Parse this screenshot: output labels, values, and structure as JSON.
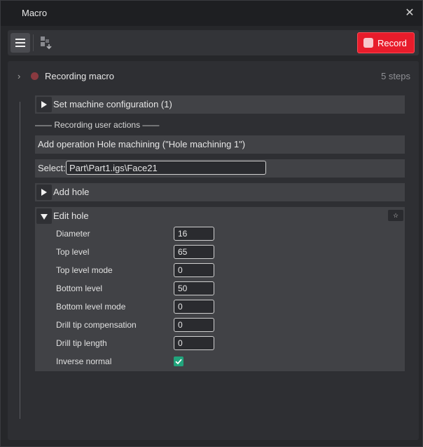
{
  "window": {
    "title": "Macro"
  },
  "toolbar": {
    "record_label": "Record"
  },
  "recording": {
    "title": "Recording macro",
    "steps": "5 steps"
  },
  "steps": {
    "set_machine": "Set machine configuration (1)",
    "section_label": "—— Recording user actions ——",
    "add_operation": "Add operation Hole machining (\"Hole machining 1\")",
    "select_label": "Select:",
    "select_value": "Part\\Part1.igs\\Face21",
    "add_hole": "Add hole",
    "edit_hole": "Edit hole"
  },
  "edit_hole": {
    "params": [
      {
        "label": "Diameter",
        "value": "16"
      },
      {
        "label": "Top level",
        "value": "65"
      },
      {
        "label": "Top level mode",
        "value": "0"
      },
      {
        "label": "Bottom level",
        "value": "50"
      },
      {
        "label": "Bottom level mode",
        "value": "0"
      },
      {
        "label": "Drill tip compensation",
        "value": "0"
      },
      {
        "label": "Drill tip length",
        "value": "0"
      }
    ],
    "inverse_normal_label": "Inverse normal",
    "inverse_normal_checked": true
  },
  "icons": {
    "close": "close-icon",
    "menu": "hamburger-menu-icon",
    "export": "export-macro-icon",
    "record": "record-dot-icon",
    "expand": "chevron-right-icon",
    "star": "star-icon",
    "check": "checkmark-icon"
  },
  "colors": {
    "record_button": "#e81c2b",
    "checkbox": "#21a47c",
    "recording_dot": "#8a3a40"
  }
}
